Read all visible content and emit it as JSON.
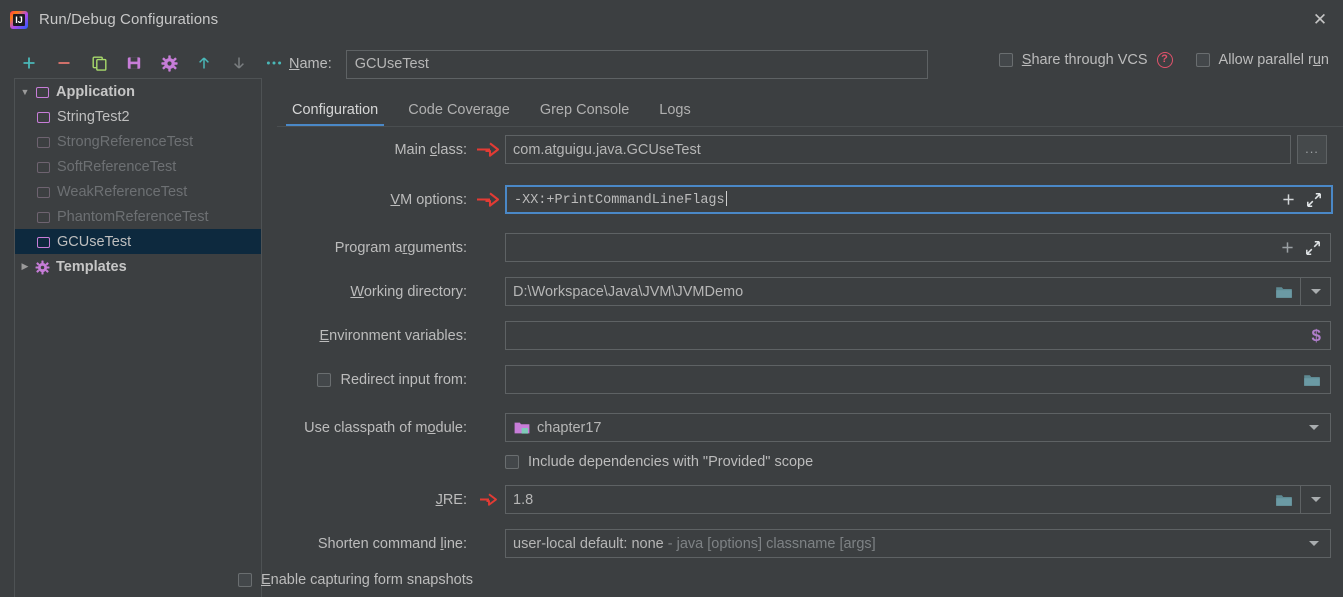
{
  "window": {
    "title": "Run/Debug Configurations",
    "app_icon": "intellij-idea-logo",
    "close_label": "✕"
  },
  "toolbar": {
    "items": [
      {
        "name": "add-configuration-button",
        "icon": "plus-icon",
        "glyph": "+",
        "color": "#4ab8b8"
      },
      {
        "name": "remove-configuration-button",
        "icon": "minus-icon",
        "glyph": "−",
        "color": "#e0766e"
      },
      {
        "name": "copy-configuration-button",
        "icon": "copy-icon",
        "glyph": "⧉",
        "color": "#a7d96b"
      },
      {
        "name": "save-configuration-button",
        "icon": "save-icon",
        "glyph": "💾",
        "color": "#c77dd8"
      },
      {
        "name": "edit-templates-button",
        "icon": "gear-icon",
        "glyph": "⚙",
        "color": "#c77dd8"
      },
      {
        "name": "move-up-button",
        "icon": "arrow-up-icon",
        "glyph": "↑",
        "color": "#4ab8b8"
      },
      {
        "name": "move-down-button",
        "icon": "arrow-down-icon",
        "glyph": "↓",
        "color": "#7a7e80"
      },
      {
        "name": "more-options-button",
        "icon": "ellipsis-icon",
        "glyph": "•••",
        "color": "#4ab8b8"
      }
    ]
  },
  "tree": {
    "nodes": [
      {
        "label": "Application",
        "icon": "application-icon",
        "expander": "▼",
        "level": 0,
        "style": "bold",
        "selected": false
      },
      {
        "label": "StringTest2",
        "icon": "run-config-icon",
        "expander": "",
        "level": 1,
        "style": "normal",
        "selected": false
      },
      {
        "label": "StrongReferenceTest",
        "icon": "run-config-icon",
        "expander": "",
        "level": 1,
        "style": "dim",
        "selected": false
      },
      {
        "label": "SoftReferenceTest",
        "icon": "run-config-icon",
        "expander": "",
        "level": 1,
        "style": "dim",
        "selected": false
      },
      {
        "label": "WeakReferenceTest",
        "icon": "run-config-icon",
        "expander": "",
        "level": 1,
        "style": "dim",
        "selected": false
      },
      {
        "label": "PhantomReferenceTest",
        "icon": "run-config-icon",
        "expander": "",
        "level": 1,
        "style": "dim",
        "selected": false
      },
      {
        "label": "GCUseTest",
        "icon": "run-config-icon",
        "expander": "",
        "level": 1,
        "style": "normal",
        "selected": true
      },
      {
        "label": "Templates",
        "icon": "gear-icon",
        "expander": "▶",
        "level": 0,
        "style": "bold",
        "selected": false
      }
    ]
  },
  "name_row": {
    "label": "Name:",
    "label_mnemonic": "N",
    "value": "GCUseTest"
  },
  "options": {
    "share_through_vcs": {
      "label": "Share through VCS",
      "mnemonic": "S",
      "checked": false
    },
    "help_icon": "help-icon",
    "allow_parallel_run": {
      "label": "Allow parallel run",
      "mnemonic": "u",
      "checked": false
    }
  },
  "tabs": [
    {
      "label": "Configuration",
      "active": true
    },
    {
      "label": "Code Coverage",
      "active": false
    },
    {
      "label": "Grep Console",
      "active": false
    },
    {
      "label": "Logs",
      "active": false
    }
  ],
  "fields": {
    "main_class": {
      "label": "Main class:",
      "value": "com.atguigu.java.GCUseTest",
      "browse_label": "..."
    },
    "vm_options": {
      "label": "VM options:",
      "value": "-XX:+PrintCommandLineFlags",
      "focused": true
    },
    "program_arguments": {
      "label": "Program arguments:",
      "value": ""
    },
    "working_directory": {
      "label": "Working directory:",
      "value": "D:\\Workspace\\Java\\JVM\\JVMDemo"
    },
    "environment_variables": {
      "label": "Environment variables:",
      "value": "",
      "macro_icon": "$"
    },
    "redirect_input": {
      "label": "Redirect input from:",
      "value": "",
      "checked": false
    },
    "use_classpath": {
      "label": "Use classpath of module:",
      "value": "chapter17",
      "icon": "module-icon"
    },
    "include_provided": {
      "label": "Include dependencies with \"Provided\" scope",
      "checked": false
    },
    "jre": {
      "label": "JRE:",
      "value": "1.8"
    },
    "shorten_command_line": {
      "label": "Shorten command line:",
      "value": "user-local default: none",
      "value_hint": " - java [options] classname [args]"
    },
    "enable_snapshots": {
      "label": "Enable capturing form snapshots",
      "checked": false
    }
  },
  "annotations": {
    "arrow_color": "#e33b34",
    "arrows_on": [
      "main_class",
      "vm_options",
      "jre"
    ]
  },
  "colors": {
    "background": "#3c3f41",
    "field_border": "#5e6264",
    "focus_blue": "#4a88c7",
    "selection": "#0d293e",
    "text": "#bcbcbc",
    "dim_text": "#6d7073",
    "purple": "#c77dd8",
    "teal": "#4ab8b8"
  }
}
